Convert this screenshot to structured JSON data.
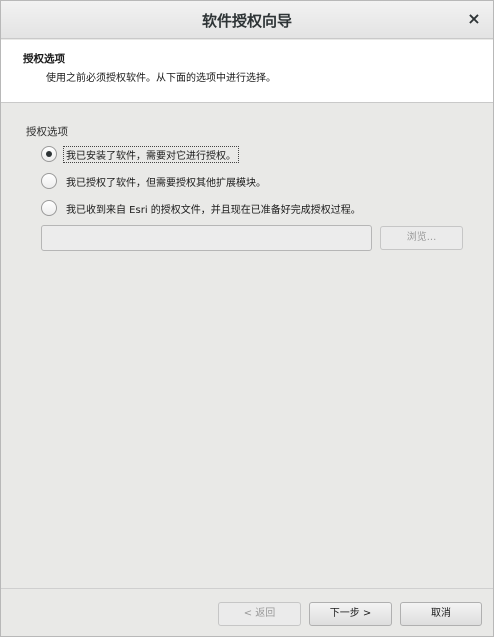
{
  "window": {
    "title": "软件授权向导",
    "close_glyph": "×"
  },
  "header": {
    "title": "授权选项",
    "description": "使用之前必须授权软件。从下面的选项中进行选择。"
  },
  "options": {
    "group_label": "授权选项",
    "items": [
      {
        "label": "我已安装了软件，需要对它进行授权。",
        "checked": true
      },
      {
        "label": "我已授权了软件，但需要授权其他扩展模块。",
        "checked": false
      },
      {
        "label": "我已收到来自 Esri 的授权文件，并且现在已准备好完成授权过程。",
        "checked": false
      }
    ]
  },
  "file": {
    "path_value": "",
    "browse_label": "浏览..."
  },
  "footer": {
    "back_label": "< 返回",
    "next_label": "下一步 >",
    "cancel_label": "取消"
  }
}
